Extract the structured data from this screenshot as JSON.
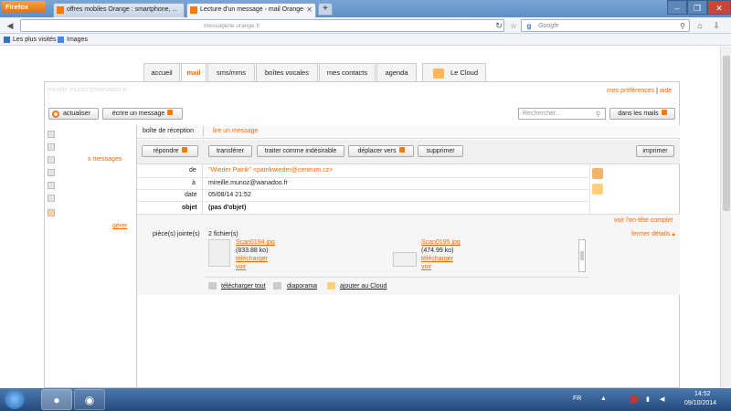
{
  "browser": {
    "menu_label": "Firefox",
    "tabs": [
      {
        "label": "offres mobiles Orange : smartphone, ..."
      },
      {
        "label": "Lecture d'un message - mail Orange"
      }
    ],
    "new_tab": "+",
    "url_text": "messagerie.orange.fr",
    "search_placeholder": "Google",
    "bookmarks": [
      "Les plus visités",
      "Images"
    ]
  },
  "mail": {
    "nav_tabs": [
      "accueil",
      "mail",
      "sms/mms",
      "boîtes vocales",
      "mes contacts",
      "agenda",
      "Le Cloud"
    ],
    "active_tab": "mail",
    "account_line": "mireille.munoz@wanadoo.fr",
    "links": {
      "prefs": "mes préférences",
      "sep": "|",
      "help": "aide"
    },
    "toolbar": {
      "refresh": "actualiser",
      "compose": "écrire un message",
      "search_placeholder": "Rechercher...",
      "scope": "dans les mails"
    },
    "breadcrumb": {
      "folder": "boîte de réception",
      "current": "lire un message"
    },
    "sidebar": {
      "cut_label": "s messages",
      "manage": "gérer"
    },
    "actions": {
      "reply": "répondre",
      "forward": "transférer",
      "spam": "traiter comme indésirable",
      "move": "déplacer vers",
      "delete": "supprimer",
      "print": "imprimer"
    },
    "message": {
      "from_label": "de",
      "from_value": "\"Wieder Patrik\" <patrikwieder@centrum.cz>",
      "to_label": "à",
      "to_value": "mireille.munoz@wanadoo.fr",
      "date_label": "date",
      "date_value": "05/08/14 21:52",
      "subject_label": "objet",
      "subject_value": "(pas d'objet)",
      "view_headers": "voir l'en-tête complet",
      "attachments_label": "pièce(s) jointe(s)",
      "attachments_count": "2 fichier(s)",
      "hide_details": "fermer détails",
      "attachments": [
        {
          "name": "Scan0194.jpg",
          "size": "(833.88 ko)",
          "download": "télécharger",
          "view": "voir"
        },
        {
          "name": "Scan0195.jpg",
          "size": "(474.99 ko)",
          "download": "télécharger",
          "view": "voir"
        }
      ],
      "footer_actions": [
        "télécharger tout",
        "diaporama",
        "ajouter au Cloud"
      ]
    }
  },
  "taskbar": {
    "lang": "FR",
    "time": "14:52",
    "date": "09/10/2014"
  },
  "colors": {
    "accent": "#ff6600",
    "titlebar": "#6a98cc",
    "taskbar": "#2f5a8d"
  }
}
